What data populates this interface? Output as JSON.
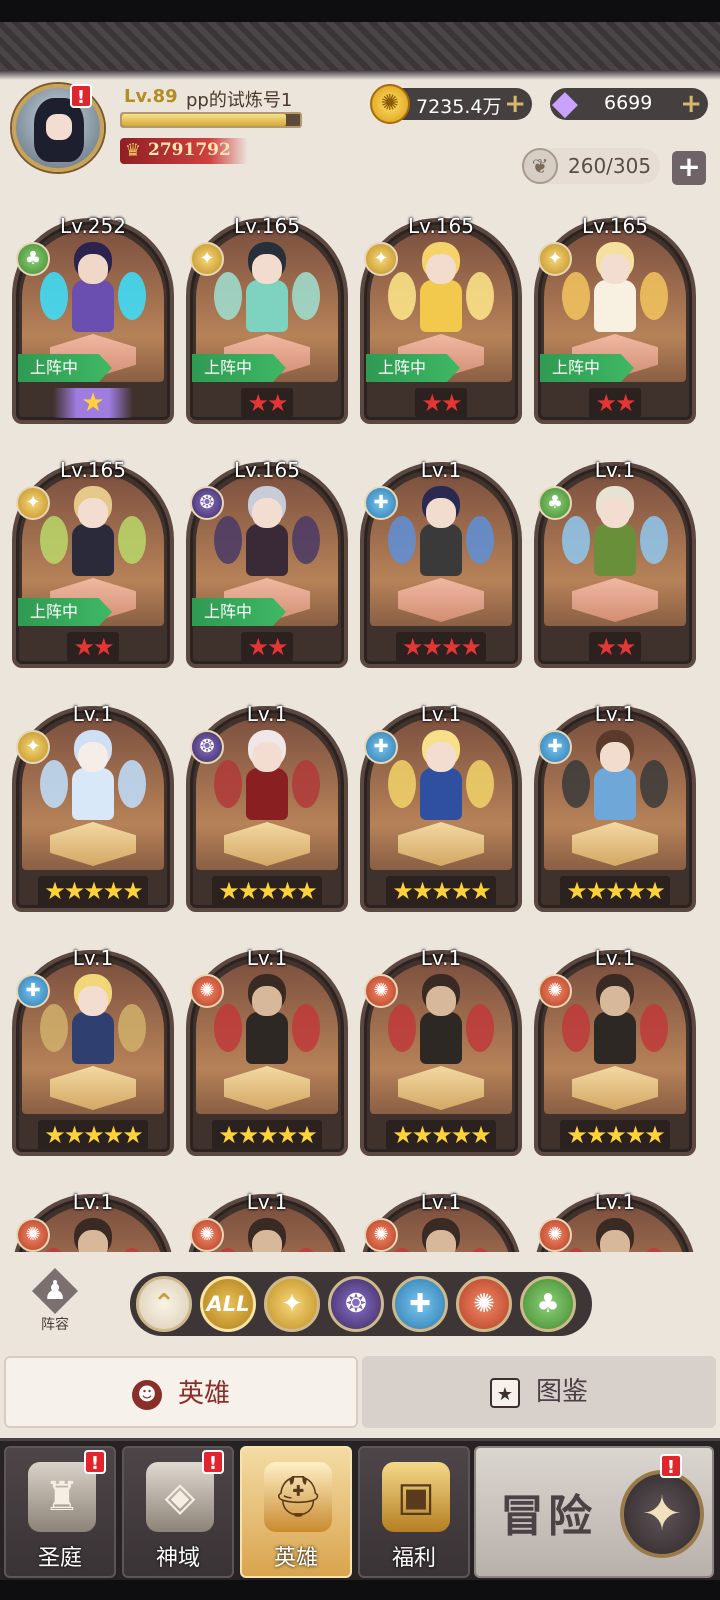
{
  "player": {
    "level": "Lv.89",
    "name": "pp的试炼号1",
    "exp_fraction": 0.92,
    "power": "2791792",
    "alert": "!"
  },
  "currency": {
    "gold": "7235.4万",
    "diamonds": "6699",
    "stamina": "260/305"
  },
  "heroes": [
    {
      "level": "Lv.252",
      "faction": "nature",
      "deployed": true,
      "stars": "★",
      "star_style": "purple"
    },
    {
      "level": "Lv.165",
      "faction": "light",
      "deployed": true,
      "stars": "★★",
      "star_style": "red"
    },
    {
      "level": "Lv.165",
      "faction": "light",
      "deployed": true,
      "stars": "★★",
      "star_style": "red"
    },
    {
      "level": "Lv.165",
      "faction": "light",
      "deployed": true,
      "stars": "★★",
      "star_style": "red"
    },
    {
      "level": "Lv.165",
      "faction": "light",
      "deployed": true,
      "stars": "★★",
      "star_style": "red"
    },
    {
      "level": "Lv.165",
      "faction": "dark",
      "deployed": true,
      "stars": "★★",
      "star_style": "red"
    },
    {
      "level": "Lv.1",
      "faction": "water",
      "deployed": false,
      "stars": "★★★★",
      "star_style": "red"
    },
    {
      "level": "Lv.1",
      "faction": "nature",
      "deployed": false,
      "stars": "★★",
      "star_style": "red"
    },
    {
      "level": "Lv.1",
      "faction": "light",
      "deployed": false,
      "stars": "★★★★★",
      "star_style": "yellow"
    },
    {
      "level": "Lv.1",
      "faction": "dark",
      "deployed": false,
      "stars": "★★★★★",
      "star_style": "yellow"
    },
    {
      "level": "Lv.1",
      "faction": "water",
      "deployed": false,
      "stars": "★★★★★",
      "star_style": "yellow"
    },
    {
      "level": "Lv.1",
      "faction": "water",
      "deployed": false,
      "stars": "★★★★★",
      "star_style": "yellow"
    },
    {
      "level": "Lv.1",
      "faction": "water",
      "deployed": false,
      "stars": "★★★★★",
      "star_style": "yellow"
    },
    {
      "level": "Lv.1",
      "faction": "fire",
      "deployed": false,
      "stars": "★★★★★",
      "star_style": "yellow"
    },
    {
      "level": "Lv.1",
      "faction": "fire",
      "deployed": false,
      "stars": "★★★★★",
      "star_style": "yellow"
    },
    {
      "level": "Lv.1",
      "faction": "fire",
      "deployed": false,
      "stars": "★★★★★",
      "star_style": "yellow"
    },
    {
      "level": "Lv.1",
      "faction": "fire",
      "deployed": false,
      "stars": "",
      "star_style": "yellow"
    },
    {
      "level": "Lv.1",
      "faction": "fire",
      "deployed": false,
      "stars": "",
      "star_style": "yellow"
    },
    {
      "level": "Lv.1",
      "faction": "fire",
      "deployed": false,
      "stars": "",
      "star_style": "yellow"
    },
    {
      "level": "Lv.1",
      "faction": "fire",
      "deployed": false,
      "stars": "",
      "star_style": "yellow"
    }
  ],
  "deployed_label": "上阵中",
  "team_label": "阵容",
  "filters": [
    {
      "name": "sort-up",
      "label": "⌃",
      "cls": "p-up"
    },
    {
      "name": "all",
      "label": "ALL",
      "cls": "p-all"
    },
    {
      "name": "light",
      "label": "✦",
      "cls": "f-light"
    },
    {
      "name": "dark",
      "label": "❂",
      "cls": "f-dark"
    },
    {
      "name": "water",
      "label": "✚",
      "cls": "f-water"
    },
    {
      "name": "fire",
      "label": "✺",
      "cls": "f-fire"
    },
    {
      "name": "nature",
      "label": "♣",
      "cls": "f-nature"
    }
  ],
  "tabs": {
    "heroes": "英雄",
    "codex": "图鉴"
  },
  "nav": {
    "court": "圣庭",
    "domain": "神域",
    "heroes": "英雄",
    "welfare": "福利",
    "adventure": "冒险"
  },
  "icons": {
    "gold": "coin-icon",
    "diamond": "diamond-icon",
    "stamina": "leaf-icon"
  }
}
